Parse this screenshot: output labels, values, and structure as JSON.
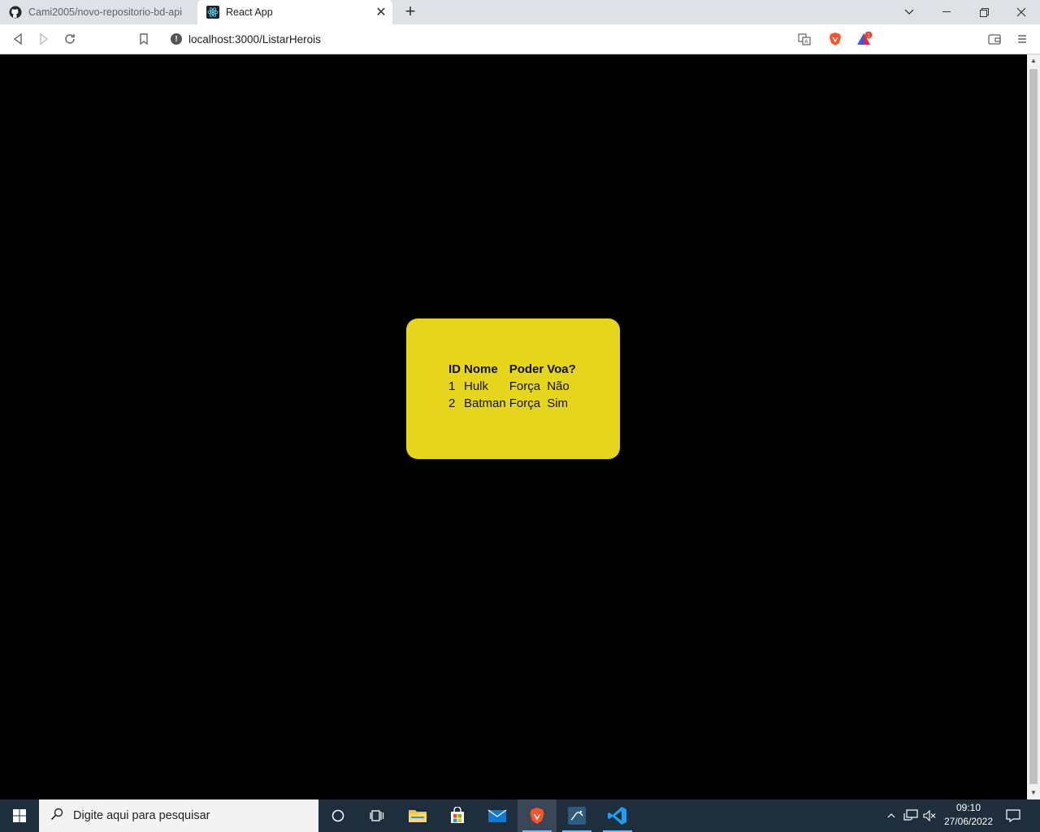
{
  "browser": {
    "tabs": [
      {
        "title": "Cami2005/novo-repositorio-bd-api",
        "active": false
      },
      {
        "title": "React App",
        "active": true
      }
    ],
    "url": "localhost:3000/ListarHerois",
    "shields_count": "1"
  },
  "page": {
    "table": {
      "headers": [
        "ID",
        "Nome",
        "Poder",
        "Voa?"
      ],
      "rows": [
        [
          "1",
          "Hulk",
          "Força",
          "Não"
        ],
        [
          "2",
          "Batman",
          "Força",
          "Sim"
        ]
      ]
    },
    "card_color": "#e5d51c",
    "background_color": "#000000"
  },
  "taskbar": {
    "search_placeholder": "Digite aqui para pesquisar",
    "time": "09:10",
    "date": "27/06/2022"
  }
}
